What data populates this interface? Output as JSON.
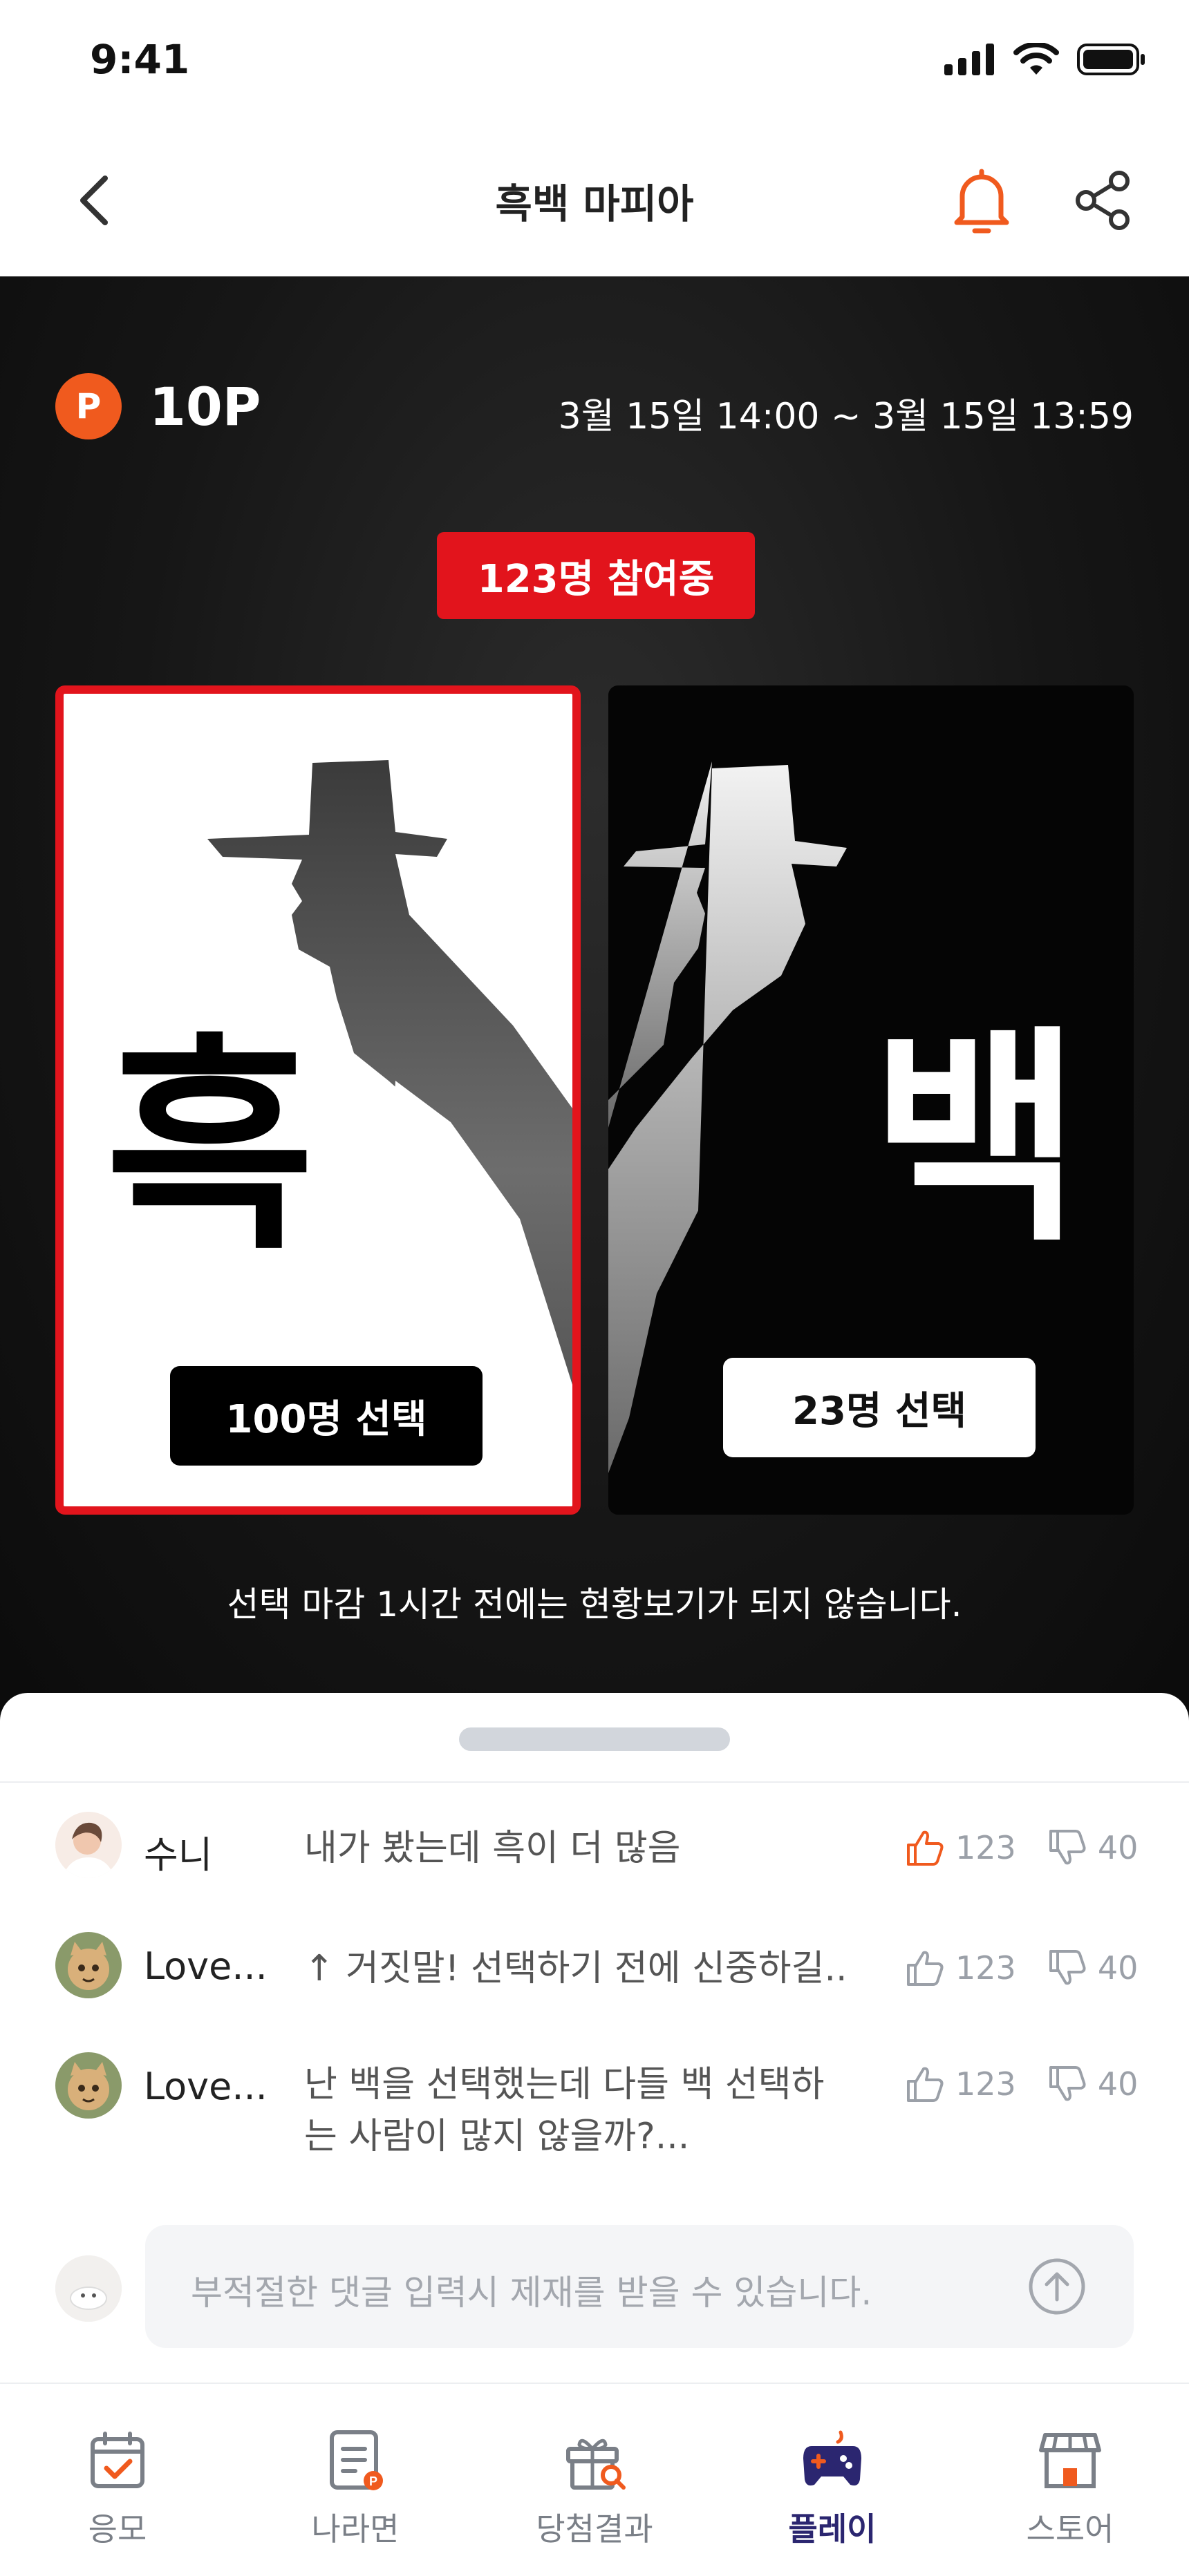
{
  "status_bar": {
    "time": "9:41"
  },
  "header": {
    "title": "흑백 마피아"
  },
  "event": {
    "points": "10P",
    "point_badge": "P",
    "period": "3월 15일 14:00 ~ 3월 15일 13:59",
    "participants": "123명 참여중",
    "options": [
      {
        "char": "흑",
        "button": "100명 선택",
        "selected": true
      },
      {
        "char": "백",
        "button": "23명 선택",
        "selected": false
      }
    ],
    "notice": "선택 마감 1시간 전에는 현황보기가 되지 않습니다."
  },
  "comments": [
    {
      "name": "수니",
      "text": "내가 봤는데 흑이 더 많음",
      "likes": "123",
      "dislikes": "40",
      "liked": true
    },
    {
      "name": "Love...",
      "text": "↑ 거짓말! 선택하기 전에 신중하길..",
      "likes": "123",
      "dislikes": "40",
      "liked": false
    },
    {
      "name": "Love...",
      "text": "난 백을 선택했는데 다들 백 선택하는 사람이 많지 않을까?...",
      "likes": "123",
      "dislikes": "40",
      "liked": false
    }
  ],
  "comment_input": {
    "placeholder": "부적절한 댓글 입력시 제재를 받을 수 있습니다."
  },
  "nav": {
    "items": [
      {
        "label": "응모",
        "icon": "calendar-check-icon"
      },
      {
        "label": "나라면",
        "icon": "list-points-icon"
      },
      {
        "label": "당첨결과",
        "icon": "gift-search-icon"
      },
      {
        "label": "플레이",
        "icon": "gamepad-icon",
        "active": true
      },
      {
        "label": "스토어",
        "icon": "store-icon"
      }
    ]
  },
  "colors": {
    "accent": "#e2141c",
    "point": "#f05a1e",
    "nav_active": "#2b2670",
    "like_active": "#f05a1e"
  }
}
